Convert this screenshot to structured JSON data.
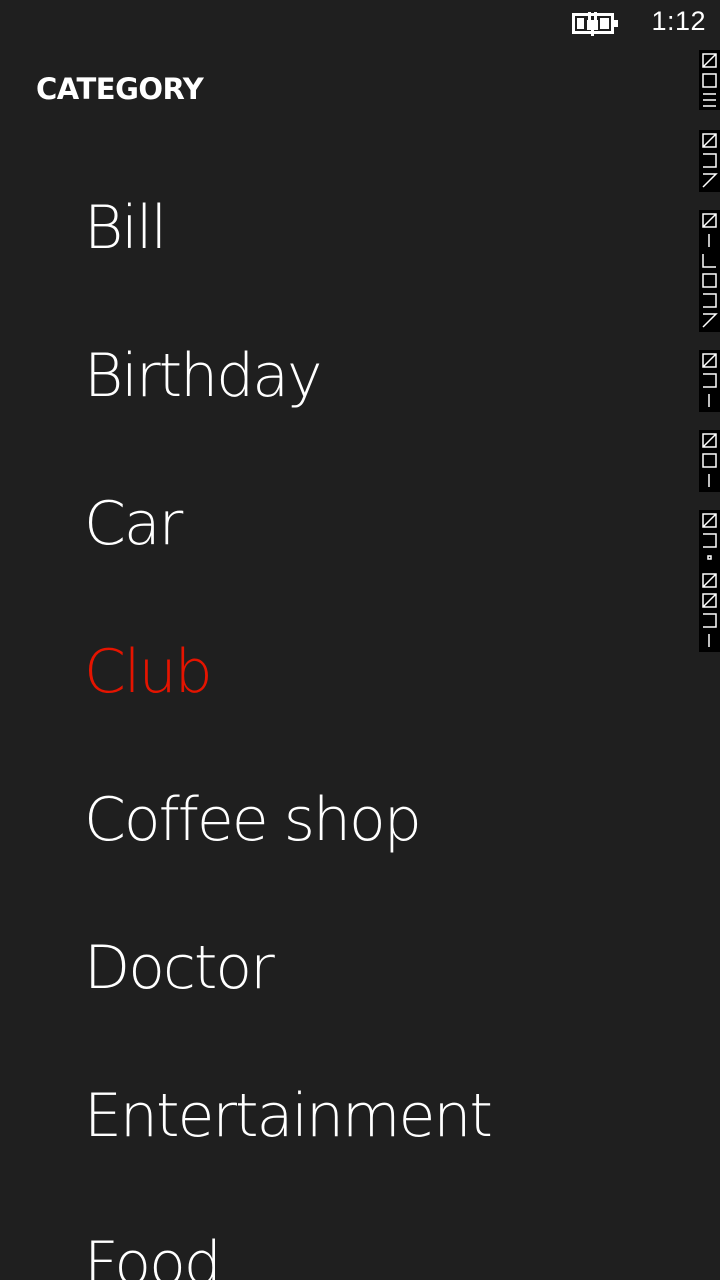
{
  "status_bar": {
    "time": "1:12",
    "battery_icon": "battery-charging-icon"
  },
  "page": {
    "title": "CATEGORY"
  },
  "categories": {
    "items": [
      {
        "label": "Bill",
        "selected": false
      },
      {
        "label": "Birthday",
        "selected": false
      },
      {
        "label": "Car",
        "selected": false
      },
      {
        "label": "Club",
        "selected": true
      },
      {
        "label": "Coffee shop",
        "selected": false
      },
      {
        "label": "Doctor",
        "selected": false
      },
      {
        "label": "Entertainment",
        "selected": false
      },
      {
        "label": "Food",
        "selected": false
      }
    ]
  },
  "colors": {
    "background": "#1f1f1f",
    "text": "#ffffff",
    "accent": "#e51400"
  }
}
